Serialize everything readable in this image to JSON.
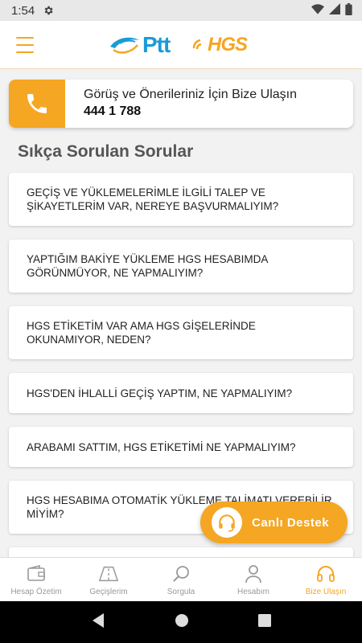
{
  "status_bar": {
    "time": "1:54"
  },
  "contact": {
    "title": "Görüş ve Önerileriniz İçin Bize Ulaşın",
    "phone": "444 1 788"
  },
  "faq": {
    "title": "Sıkça Sorulan Sorular",
    "items": [
      "GEÇİŞ VE YÜKLEMELERİMLE İLGİLİ TALEP VE ŞİKAYETLERİM VAR, NEREYE BAŞVURMALIYIM?",
      "YAPTIĞIM BAKİYE YÜKLEME HGS HESABIMDA GÖRÜNMÜYOR, NE YAPMALIYIM?",
      "HGS ETİKETİM VAR AMA HGS GİŞELERİNDE OKUNAMIYOR, NEDEN?",
      "HGS'DEN İHLALLİ GEÇİŞ YAPTIM, NE YAPMALIYIM?",
      "ARABAMI SATTIM, HGS ETİKETİMİ NE YAPMALIYIM?",
      "HGS HESABIMA OTOMATİK YÜKLEME TALİMATI VEREBİLİR MİYİM?",
      ""
    ]
  },
  "logos": {
    "ptt": "Ptt",
    "hgs": "HGS"
  },
  "live_support": {
    "label": "Canlı Destek"
  },
  "nav": {
    "items": [
      {
        "label": "Hesap Özetim",
        "icon": "wallet-icon"
      },
      {
        "label": "Geçişlerim",
        "icon": "road-icon"
      },
      {
        "label": "Sorgula",
        "icon": "search-icon"
      },
      {
        "label": "Hesabım",
        "icon": "person-icon"
      },
      {
        "label": "Bize Ulaşın",
        "icon": "headset-icon"
      }
    ],
    "active_index": 4
  },
  "colors": {
    "accent": "#f5a623",
    "ptt_blue": "#1a9bd7"
  }
}
